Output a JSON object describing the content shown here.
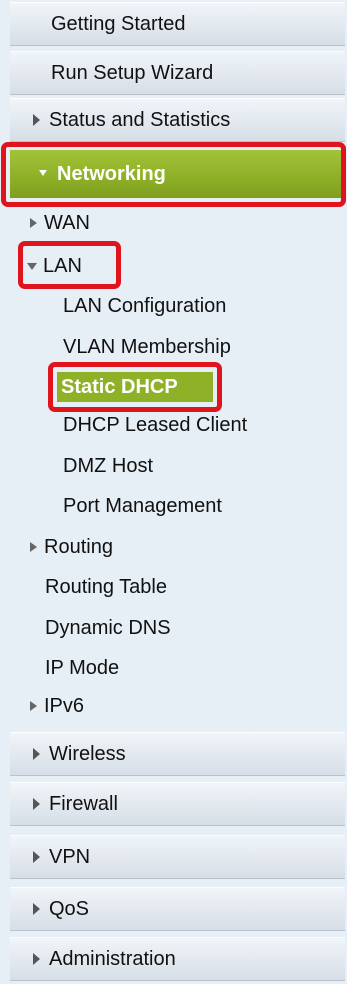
{
  "menu": {
    "getting_started": "Getting Started",
    "run_setup_wizard": "Run Setup Wizard",
    "status_and_statistics": "Status and Statistics",
    "networking": "Networking",
    "networking_sub": {
      "wan": "WAN",
      "lan": "LAN",
      "lan_items": [
        "LAN Configuration",
        "VLAN Membership",
        "Static DHCP",
        "DHCP Leased Client",
        "DMZ Host",
        "Port Management"
      ],
      "routing": "Routing",
      "routing_items": [
        "Routing Table",
        "Dynamic DNS",
        "IP Mode"
      ],
      "ipv6": "IPv6"
    },
    "wireless": "Wireless",
    "firewall": "Firewall",
    "vpn": "VPN",
    "qos": "QoS",
    "administration": "Administration"
  },
  "colors": {
    "accent_green": "#8fb128",
    "highlight_red": "#e0141d",
    "sidebar_bg": "#e6eef6"
  },
  "icons": {
    "collapsed": "triangle-right-icon",
    "expanded": "triangle-down-icon"
  }
}
